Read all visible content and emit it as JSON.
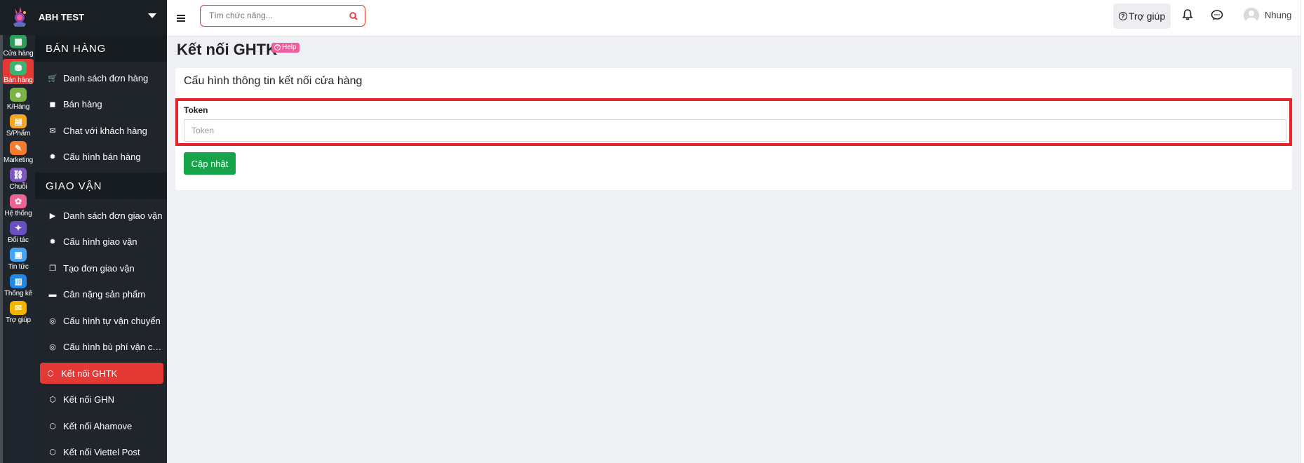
{
  "brand": {
    "name": "ABH TEST"
  },
  "rail": [
    {
      "label": "Cửa hàng",
      "icon": "store-icon",
      "color": "#2e9e5b"
    },
    {
      "label": "Bán hàng",
      "icon": "cash-register-icon",
      "color": "#3cb371",
      "active": true
    },
    {
      "label": "K/Hàng",
      "icon": "customer-icon",
      "color": "#7cb342"
    },
    {
      "label": "S/Phẩm",
      "icon": "product-icon",
      "color": "#f5a623"
    },
    {
      "label": "Marketing",
      "icon": "tag-icon",
      "color": "#f57c2c"
    },
    {
      "label": "Chuỗi",
      "icon": "chain-icon",
      "color": "#7e57c2"
    },
    {
      "label": "Hệ thống",
      "icon": "system-icon",
      "color": "#f06292"
    },
    {
      "label": "Đối tác",
      "icon": "handshake-icon",
      "color": "#6a4fc2"
    },
    {
      "label": "Tin tức",
      "icon": "news-icon",
      "color": "#42a5f5"
    },
    {
      "label": "Thống kê",
      "icon": "stats-icon",
      "color": "#1e88e5"
    },
    {
      "label": "Trợ giúp",
      "icon": "help-icon",
      "color": "#f4b400"
    }
  ],
  "sidebar": {
    "sections": [
      {
        "title": "BÁN HÀNG",
        "items": [
          {
            "label": "Danh sách đơn hàng",
            "icon": "cart-icon"
          },
          {
            "label": "Bán hàng",
            "icon": "bag-icon"
          },
          {
            "label": "Chat với khách hàng",
            "icon": "chat-icon"
          },
          {
            "label": "Cấu hình bán hàng",
            "icon": "gear-icon"
          }
        ]
      },
      {
        "title": "GIAO VẬN",
        "items": [
          {
            "label": "Danh sách đơn giao vận",
            "icon": "truck-icon"
          },
          {
            "label": "Cấu hình giao vận",
            "icon": "gear-icon"
          },
          {
            "label": "Tạo đơn giao vận",
            "icon": "copy-icon"
          },
          {
            "label": "Cân nặng sản phẩm",
            "icon": "box-icon"
          },
          {
            "label": "Cấu hình tự vận chuyển",
            "icon": "circle-icon"
          },
          {
            "label": "Cấu hình bù phí vận ch...",
            "icon": "circle-icon"
          },
          {
            "label": "Kết nối GHTK",
            "icon": "network-icon",
            "active": true
          },
          {
            "label": "Kết nối GHN",
            "icon": "network-icon"
          },
          {
            "label": "Kết nối Ahamove",
            "icon": "network-icon"
          },
          {
            "label": "Kết nối Viettel Post",
            "icon": "network-icon"
          }
        ]
      }
    ]
  },
  "topbar": {
    "search_placeholder": "Tìm chức năng...",
    "help_label": "Trợ giúp",
    "user_name": "Nhung"
  },
  "main": {
    "page_title": "Kết nối GHTK",
    "help_badge": "Help",
    "card_title": "Cấu hình thông tin kết nối cửa hàng",
    "token_label": "Token",
    "token_placeholder": "Token",
    "token_value": "",
    "update_button": "Cập nhật"
  },
  "colors": {
    "accent_red": "#e53935",
    "highlight_red": "#e3242b",
    "button_green": "#16a34a",
    "help_pink": "#ec5f9c"
  }
}
